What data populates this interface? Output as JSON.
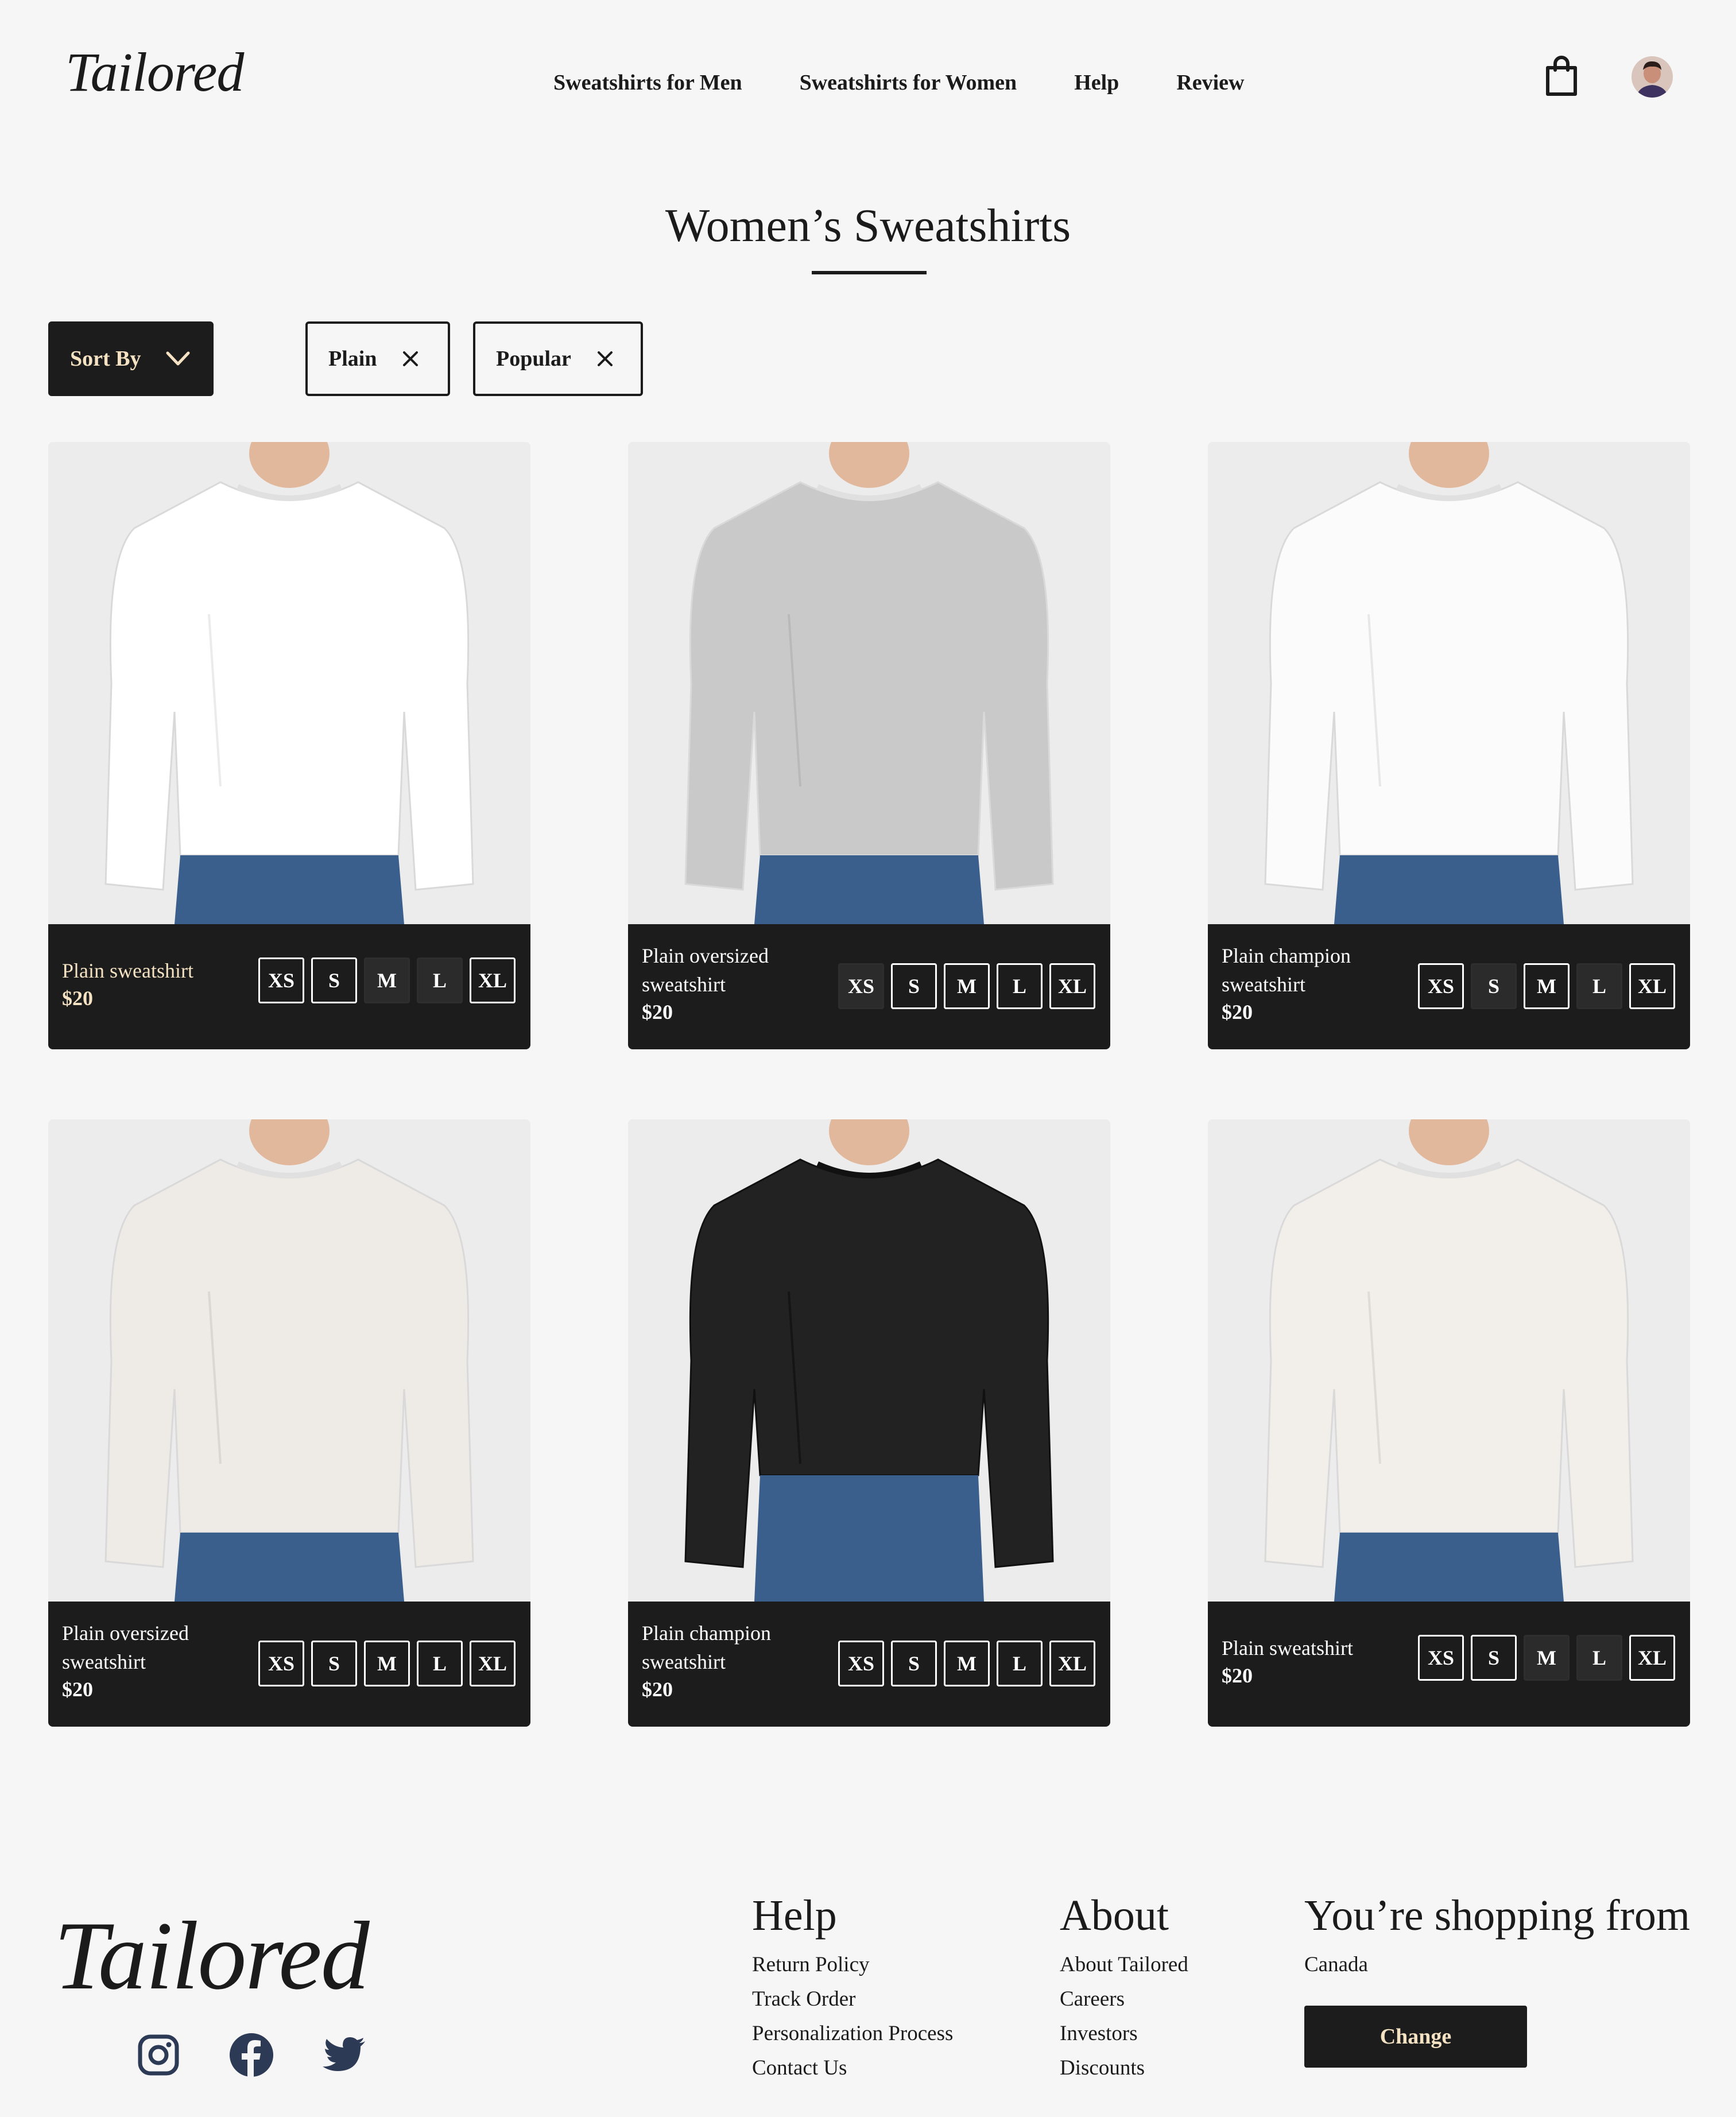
{
  "header": {
    "logo": "Tailored",
    "nav": [
      "Sweatshirts for Men",
      "Sweatshirts for Women",
      "Help",
      "Review"
    ],
    "bag_icon": "shopping-bag-icon",
    "avatar_icon": "user-avatar"
  },
  "page": {
    "title": "Women’s Sweatshirts"
  },
  "filters": {
    "sort_label": "Sort By",
    "chips": [
      {
        "label": "Plain",
        "icon": "close-icon"
      },
      {
        "label": "Popular",
        "icon": "close-icon"
      }
    ]
  },
  "products": [
    {
      "name": "Plain sweatshirt",
      "price": "$20",
      "name_color": "#f4e2c3",
      "price_color": "#f4e2c3",
      "garment_color": "#ffffff",
      "unavailable": [
        "M",
        "L"
      ]
    },
    {
      "name": "Plain oversized sweatshirt",
      "price": "$20",
      "name_color": "#ffffff",
      "price_color": "#ffffff",
      "garment_color": "#c9c9c9",
      "unavailable": [
        "XS"
      ]
    },
    {
      "name": "Plain champion sweatshirt",
      "price": "$20",
      "name_color": "#ffffff",
      "price_color": "#ffffff",
      "garment_color": "#fbfbfb",
      "unavailable": [
        "S",
        "L"
      ]
    },
    {
      "name": "Plain oversized sweatshirt",
      "price": "$20",
      "name_color": "#ffffff",
      "price_color": "#ffffff",
      "garment_color": "#eeeae6",
      "unavailable": []
    },
    {
      "name": "Plain champion sweatshirt",
      "price": "$20",
      "name_color": "#ffffff",
      "price_color": "#ffffff",
      "garment_color": "#222222",
      "unavailable": []
    },
    {
      "name": "Plain sweatshirt",
      "price": "$20",
      "name_color": "#ffffff",
      "price_color": "#ffffff",
      "garment_color": "#f2efeb",
      "unavailable": [
        "M",
        "L"
      ]
    }
  ],
  "sizes": [
    "XS",
    "S",
    "M",
    "L",
    "XL"
  ],
  "footer": {
    "logo": "Tailored",
    "social": [
      "instagram-icon",
      "facebook-icon",
      "twitter-icon"
    ],
    "help": {
      "title": "Help",
      "links": [
        "Return Policy",
        "Track Order",
        "Personalization Process",
        "Contact Us"
      ]
    },
    "about": {
      "title": "About",
      "links": [
        "About Tailored",
        "Careers",
        "Investors",
        "Discounts"
      ]
    },
    "region": {
      "title": "You’re shopping from",
      "country": "Canada",
      "button": "Change"
    }
  },
  "colors": {
    "dark": "#1c1c1c",
    "accent": "#f4e2c3",
    "background": "#f6f6f6",
    "social": "#2c3a55"
  }
}
